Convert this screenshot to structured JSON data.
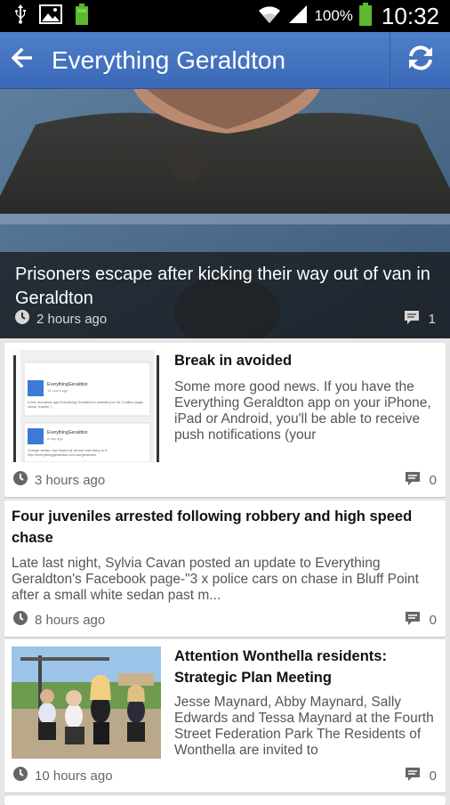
{
  "status_bar": {
    "icons": [
      "usb-icon",
      "image-icon",
      "battery-small-icon",
      "wifi-icon",
      "signal-icon",
      "battery-icon"
    ],
    "battery_pct": "100%",
    "time": "10:32"
  },
  "app_bar": {
    "title": "Everything Geraldton",
    "back_icon": "arrow-left-icon",
    "refresh_icon": "refresh-icon",
    "color": "#3a69b7"
  },
  "hero": {
    "title": "Prisoners escape after kicking their way out of van in Geraldton",
    "time": "2 hours ago",
    "comments": "1"
  },
  "articles": [
    {
      "title": "Break in avoided",
      "excerpt": "Some more good news. If you have the Everything Geraldton app on your iPhone, iPad or Android, you'll be able to receive push notifications (your",
      "time": "3 hours ago",
      "comments": "0",
      "thumb": {
        "post1_name": "EverythingGeraldton",
        "post1_time": "12 hours ago",
        "post1_text": "A few moments ago Everything Geraldton's website just hit 1 million page views, thanks :)",
        "post2_name": "EverythingGeraldton",
        "post2_time": "A day ago",
        "post2_text": "Orange sedan now towed at vehicle with baby in it. http://everythinggeraldton.com.au/geraldton"
      }
    },
    {
      "title": "Four juveniles arrested following robbery and high speed chase",
      "excerpt": "Late last night, Sylvia Cavan posted an update to Everything Geraldton's Facebook page-\"3 x police cars on chase in Bluff Point after a small white sedan past m...",
      "time": "8 hours ago",
      "comments": "0"
    },
    {
      "title": "Attention Wonthella residents: Strategic Plan Meeting",
      "excerpt": "Jesse Maynard, Abby Maynard, Sally Edwards and Tessa Maynard at the Fourth Street Federation Park  The Residents of Wonthella are invited to",
      "time": "10 hours ago",
      "comments": "0"
    }
  ]
}
